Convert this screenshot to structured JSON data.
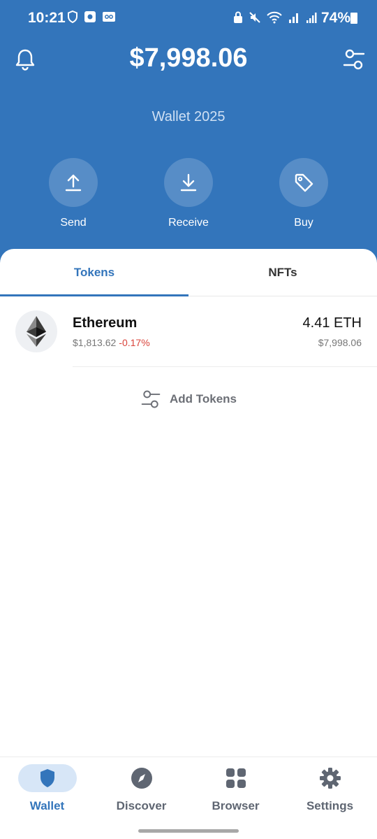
{
  "status_bar": {
    "time": "10:21",
    "battery": "74%"
  },
  "header": {
    "balance": "$7,998.06",
    "wallet_name": "Wallet 2025",
    "actions": [
      {
        "label": "Send",
        "icon": "upload-arrow-icon"
      },
      {
        "label": "Receive",
        "icon": "download-arrow-icon"
      },
      {
        "label": "Buy",
        "icon": "tag-icon"
      }
    ]
  },
  "tabs": [
    {
      "label": "Tokens",
      "active": true
    },
    {
      "label": "NFTs",
      "active": false
    }
  ],
  "tokens": [
    {
      "name": "Ethereum",
      "price": "$1,813.62",
      "change": "-0.17%",
      "amount": "4.41 ETH",
      "fiat_value": "$7,998.06",
      "icon": "ethereum-logo-icon"
    }
  ],
  "add_tokens_label": "Add Tokens",
  "bottom_nav": [
    {
      "label": "Wallet",
      "icon": "shield-icon",
      "active": true
    },
    {
      "label": "Discover",
      "icon": "compass-icon",
      "active": false
    },
    {
      "label": "Browser",
      "icon": "grid-icon",
      "active": false
    },
    {
      "label": "Settings",
      "icon": "gear-icon",
      "active": false
    }
  ],
  "colors": {
    "primary": "#3375bb",
    "negative_change": "#d9443b",
    "active_nav_bg": "#d7e6f7"
  }
}
